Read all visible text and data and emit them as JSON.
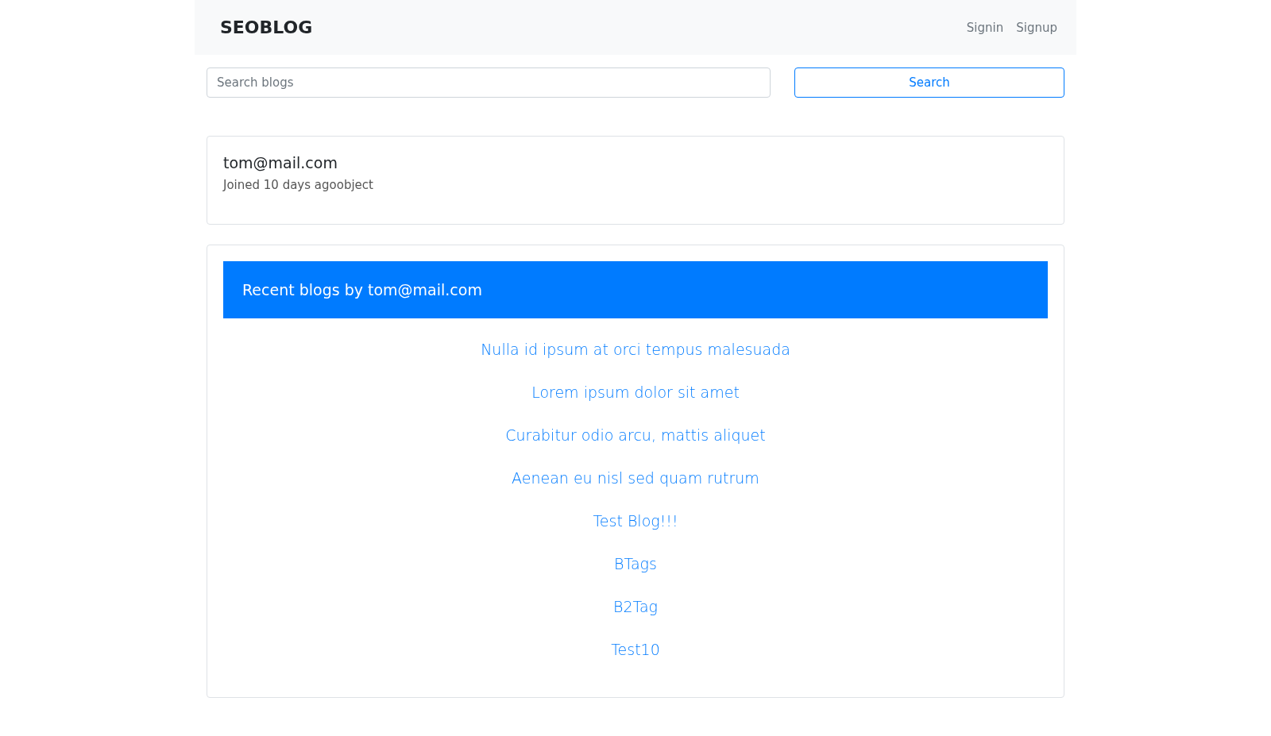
{
  "navbar": {
    "brand": "SEOBLOG",
    "links": [
      "Signin",
      "Signup"
    ]
  },
  "search": {
    "placeholder": "Search blogs",
    "button": "Search"
  },
  "profile": {
    "email": "tom@mail.com",
    "joined": "Joined 10 days agoobject"
  },
  "recent": {
    "title": "Recent blogs by tom@mail.com",
    "blogs": [
      "Nulla id ipsum at orci tempus malesuada",
      "Lorem ipsum dolor sit amet",
      "Curabitur odio arcu, mattis aliquet",
      "Aenean eu nisl sed quam rutrum",
      "Test Blog!!!",
      "BTags",
      "B2Tag",
      "Test10"
    ]
  }
}
